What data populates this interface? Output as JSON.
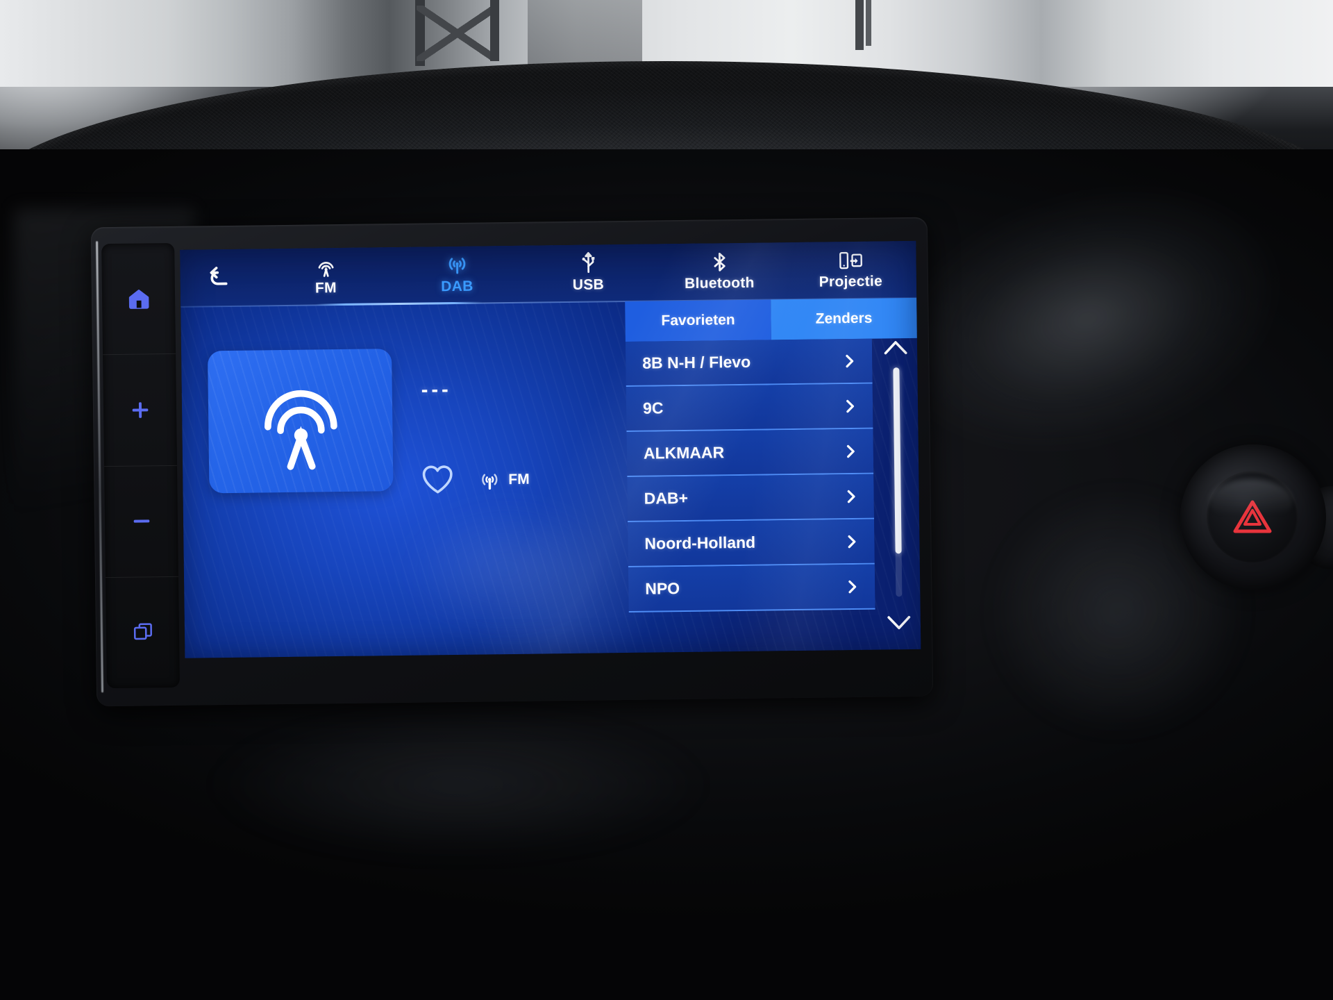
{
  "device": {
    "name": "car-infotainment-head-unit",
    "screen_mode": "DAB radio"
  },
  "hardware_keys": [
    {
      "name": "home",
      "icon": "home-icon"
    },
    {
      "name": "volume-up",
      "icon": "plus-icon"
    },
    {
      "name": "volume-down",
      "icon": "minus-icon"
    },
    {
      "name": "apps",
      "icon": "windows-apps-icon"
    }
  ],
  "nav": {
    "back_icon": "back-arrow-icon",
    "items": [
      {
        "label": "FM",
        "icon": "broadcast-tower-icon",
        "active": false
      },
      {
        "label": "DAB",
        "icon": "radio-waves-icon",
        "active": true
      },
      {
        "label": "USB",
        "icon": "usb-icon",
        "active": false
      },
      {
        "label": "Bluetooth",
        "icon": "bluetooth-icon",
        "active": false
      },
      {
        "label": "Projectie",
        "icon": "screen-mirroring-icon",
        "active": false
      }
    ]
  },
  "now_playing": {
    "artwork_icon": "broadcast-tower-icon",
    "station_title": "---",
    "favorite_icon": "heart-outline-icon",
    "band_icon": "antenna-signal-icon",
    "band_label": "FM"
  },
  "list_panel": {
    "tabs": [
      {
        "label": "Favorieten",
        "active": false
      },
      {
        "label": "Zenders",
        "active": true
      }
    ],
    "rows": [
      {
        "label": "8B N-H / Flevo",
        "chevron": "chevron-right-icon"
      },
      {
        "label": "9C",
        "chevron": "chevron-right-icon"
      },
      {
        "label": "ALKMAAR",
        "chevron": "chevron-right-icon"
      },
      {
        "label": "DAB+",
        "chevron": "chevron-right-icon"
      },
      {
        "label": "Noord-Holland",
        "chevron": "chevron-right-icon"
      },
      {
        "label": "NPO",
        "chevron": "chevron-right-icon"
      }
    ],
    "scroll_up_icon": "chevron-up-icon",
    "scroll_down_icon": "chevron-down-icon"
  },
  "dashboard_controls": {
    "hazard_icon": "hazard-triangle-icon"
  },
  "colors": {
    "screen_blue": "#1745bd",
    "accent_blue": "#3a9bff",
    "tab_active": "#2f86f5",
    "tab_inactive": "#1f5ee0",
    "row_bg": "#143fa8",
    "row_divider": "#4c8bf5",
    "hardware_key_icon": "#5b6cf0",
    "hazard_red": "#e8343c"
  }
}
